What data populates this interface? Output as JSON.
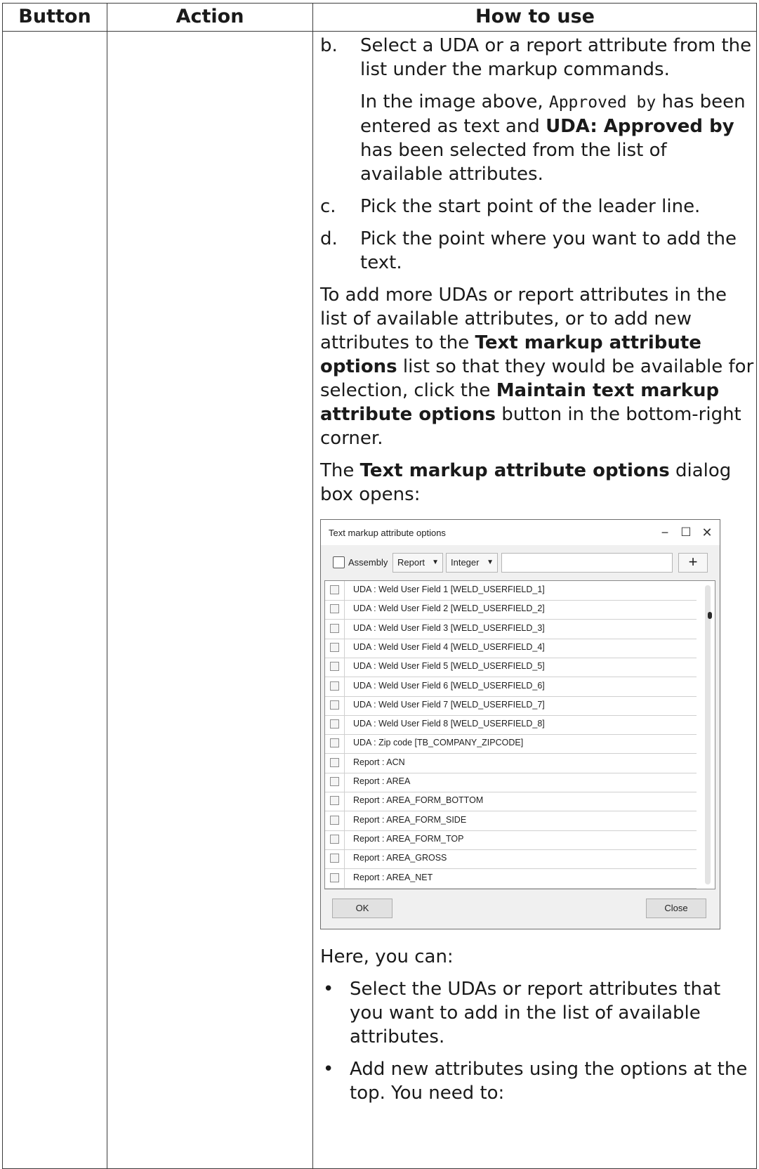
{
  "table": {
    "headers": [
      "Button",
      "Action",
      "How to use"
    ]
  },
  "steps": [
    {
      "mark": "b.",
      "text": "Select a UDA or a report attribute from the list under the markup commands."
    },
    {
      "mark": "c.",
      "text": "Pick the start point of the leader line."
    },
    {
      "mark": "d.",
      "text": "Pick the point where you want to add the text."
    }
  ],
  "step_b_note": {
    "t1": "In the image above, ",
    "code": "Approved by",
    "t2": " has been entered as text and ",
    "bold": "UDA: Approved by",
    "t3": " has been selected from the list of available attributes."
  },
  "para1": {
    "t1": "To add more UDAs or report attributes in the list of available attributes, or to add new attributes to the ",
    "b1": "Text markup attribute options",
    "t2": " list so that they would be available for selection, click the ",
    "b2": "Maintain text markup attribute options",
    "t3": " button in the bottom-right corner."
  },
  "para2": {
    "t1": "The ",
    "b1": "Text markup attribute options",
    "t2": " dialog box opens:"
  },
  "dialog": {
    "title": "Text markup attribute options",
    "minimize": "−",
    "maximize": "☐",
    "close": "✕",
    "assembly_label": "Assembly",
    "type_select": "Report",
    "format_select": "Integer",
    "add_label": "+",
    "rows": [
      "UDA : Weld User Field 1 [WELD_USERFIELD_1]",
      "UDA : Weld User Field 2 [WELD_USERFIELD_2]",
      "UDA : Weld User Field 3 [WELD_USERFIELD_3]",
      "UDA : Weld User Field 4 [WELD_USERFIELD_4]",
      "UDA : Weld User Field 5 [WELD_USERFIELD_5]",
      "UDA : Weld User Field 6 [WELD_USERFIELD_6]",
      "UDA : Weld User Field 7 [WELD_USERFIELD_7]",
      "UDA : Weld User Field 8 [WELD_USERFIELD_8]",
      "UDA : Zip code [TB_COMPANY_ZIPCODE]",
      "Report : ACN",
      "Report : AREA",
      "Report : AREA_FORM_BOTTOM",
      "Report : AREA_FORM_SIDE",
      "Report : AREA_FORM_TOP",
      "Report : AREA_GROSS",
      "Report : AREA_NET"
    ],
    "ok_label": "OK",
    "close_label": "Close"
  },
  "here_text": "Here, you can:",
  "bullets": [
    "Select the UDAs or report attributes that you want to add in the list of available attributes.",
    "Add new attributes using the options at the top. You need to:"
  ],
  "bullet_mark": "•"
}
